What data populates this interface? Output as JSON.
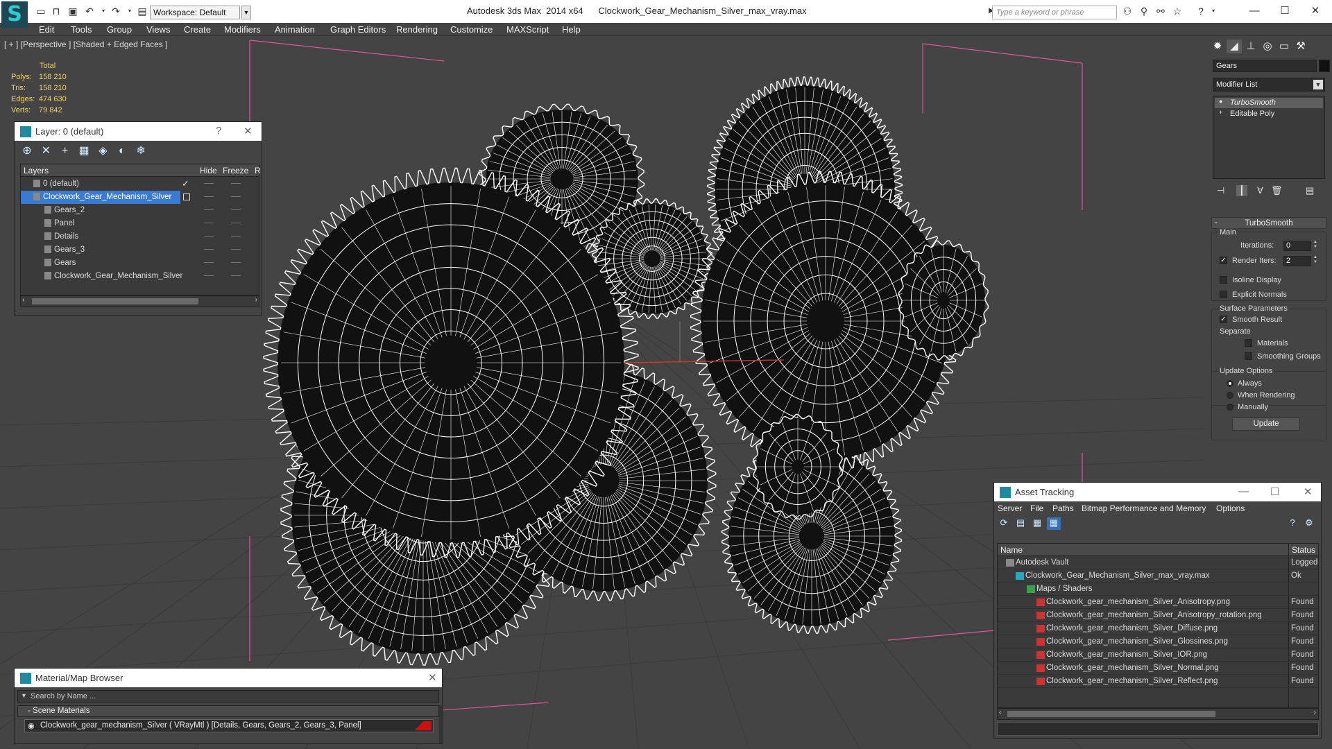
{
  "titlebar": {
    "workspace": "Workspace: Default",
    "app_name": "Autodesk 3ds Max  2014 x64",
    "file_name": "Clockwork_Gear_Mechanism_Silver_max_vray.max",
    "search_placeholder": "Type a keyword or phrase"
  },
  "menu": [
    "Edit",
    "Tools",
    "Group",
    "Views",
    "Create",
    "Modifiers",
    "Animation",
    "Graph Editors",
    "Rendering",
    "Customize",
    "MAXScript",
    "Help"
  ],
  "viewport": {
    "label": "[ + ] [Perspective ] [Shaded + Edged Faces ]",
    "stats": {
      "header": "Total",
      "rows": [
        {
          "label": "Polys:",
          "value": "158 210"
        },
        {
          "label": "Tris:",
          "value": "158 210"
        },
        {
          "label": "Edges:",
          "value": "474 630"
        },
        {
          "label": "Verts:",
          "value": "79 842"
        }
      ]
    }
  },
  "layer_panel": {
    "title": "Layer: 0 (default)",
    "columns": [
      "Layers",
      "Hide",
      "Freeze",
      "R"
    ],
    "rows": [
      {
        "name": "0 (default)",
        "checked": true
      },
      {
        "name": "Clockwork_Gear_Mechanism_Silver",
        "selected": true
      },
      {
        "name": "Gears_2"
      },
      {
        "name": "Panel"
      },
      {
        "name": "Details"
      },
      {
        "name": "Gears_3"
      },
      {
        "name": "Gears"
      },
      {
        "name": "Clockwork_Gear_Mechanism_Silver"
      }
    ]
  },
  "command_panel": {
    "object_name": "Gears",
    "modifier_list": "Modifier List",
    "stack": [
      "TurboSmooth",
      "Editable Poly"
    ],
    "turbosmooth": {
      "title": "TurboSmooth",
      "main_label": "Main",
      "iterations_label": "Iterations:",
      "iterations_value": "0",
      "render_iters_label": "Render Iters:",
      "render_iters_value": "2",
      "isoline_label": "Isoline Display",
      "explicit_label": "Explicit Normals",
      "surface_label": "Surface Parameters",
      "smooth_label": "Smooth Result",
      "separate_label": "Separate",
      "materials_label": "Materials",
      "smoothing_label": "Smoothing Groups",
      "update_options_label": "Update Options",
      "always_label": "Always",
      "when_rendering_label": "When Rendering",
      "manually_label": "Manually",
      "update_button": "Update"
    }
  },
  "asset_panel": {
    "title": "Asset Tracking",
    "menu": [
      "Server",
      "File",
      "Paths",
      "Bitmap Performance and Memory",
      "Options"
    ],
    "columns": [
      "Name",
      "Status"
    ],
    "rows": [
      {
        "name": "Autodesk Vault",
        "status": "Logged",
        "indent": 0
      },
      {
        "name": "Clockwork_Gear_Mechanism_Silver_max_vray.max",
        "status": "Ok",
        "indent": 1
      },
      {
        "name": "Maps / Shaders",
        "status": "",
        "indent": 2
      },
      {
        "name": "Clockwork_gear_mechanism_Silver_Anisotropy.png",
        "status": "Found",
        "indent": 3
      },
      {
        "name": "Clockwork_gear_mechanism_Silver_Anisotropy_rotation.png",
        "status": "Found",
        "indent": 3
      },
      {
        "name": "Clockwork_gear_mechanism_Silver_Diffuse.png",
        "status": "Found",
        "indent": 3
      },
      {
        "name": "Clockwork_gear_mechanism_Silver_Glossines.png",
        "status": "Found",
        "indent": 3
      },
      {
        "name": "Clockwork_gear_mechanism_Silver_IOR.png",
        "status": "Found",
        "indent": 3
      },
      {
        "name": "Clockwork_gear_mechanism_Silver_Normal.png",
        "status": "Found",
        "indent": 3
      },
      {
        "name": "Clockwork_gear_mechanism_Silver_Reflect.png",
        "status": "Found",
        "indent": 3
      }
    ]
  },
  "material_panel": {
    "title": "Material/Map Browser",
    "search_placeholder": "Search by Name ...",
    "group": "- Scene Materials",
    "item": "Clockwork_gear_mechanism_Silver  ( VRayMtl )  [Details, Gears, Gears_2, Gears_3, Panel]"
  },
  "colors": {
    "selection": "#3a7ad0",
    "stats_text": "#f0d46a",
    "viewport_bg": "#444444",
    "wireframe": "#ffffff",
    "bbox": "#e0569a"
  }
}
